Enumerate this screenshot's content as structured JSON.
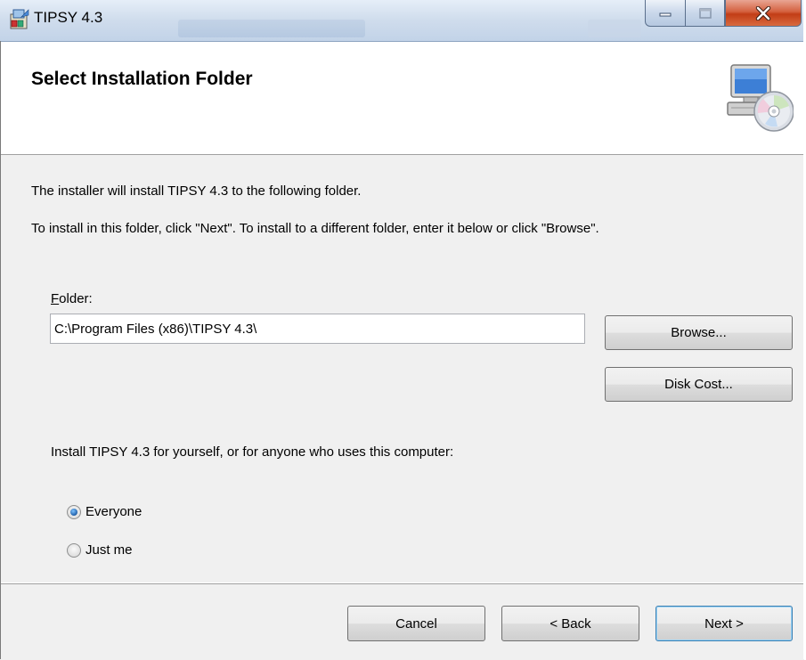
{
  "window": {
    "title": "TIPSY 4.3"
  },
  "header": {
    "title": "Select Installation Folder"
  },
  "body": {
    "intro": "The installer will install TIPSY 4.3 to the following folder.",
    "instructions": "To install in this folder, click \"Next\". To install to a different folder, enter it below or click \"Browse\".",
    "folder_label_accel": "F",
    "folder_label_rest": "older:",
    "folder_value": "C:\\Program Files (x86)\\TIPSY 4.3\\",
    "browse_label": "Browse...",
    "disk_cost_label": "Disk Cost...",
    "scope_question": "Install TIPSY 4.3 for yourself, or for anyone who uses this computer:",
    "options": [
      {
        "label": "Everyone",
        "selected": true
      },
      {
        "label": "Just me",
        "selected": false
      }
    ]
  },
  "footer": {
    "cancel_label": "Cancel",
    "back_label": "< Back",
    "next_label": "Next >"
  },
  "colors": {
    "title_bar": "#cfdcec",
    "close_button": "#c9461f",
    "dialog_bg": "#f0f0f0",
    "radio_dot": "#1f5ea8"
  }
}
